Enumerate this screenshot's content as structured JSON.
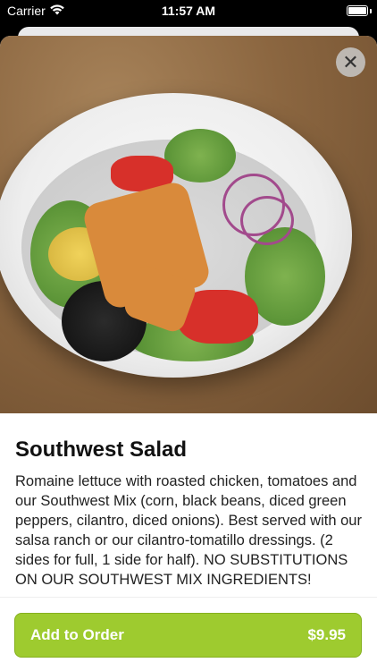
{
  "status_bar": {
    "carrier": "Carrier",
    "time": "11:57 AM"
  },
  "item": {
    "name": "Southwest Salad",
    "description": "Romaine lettuce with roasted chicken, tomatoes and our Southwest Mix (corn, black beans, diced green peppers, cilantro, diced onions). Best served with our salsa ranch or our cilantro-tomatillo dressings. (2 sides for full, 1 side for half). NO SUBSTITUTIONS ON OUR SOUTHWEST MIX INGREDIENTS!",
    "image_alt": "Southwest Salad photo"
  },
  "close": {
    "label": "✕"
  },
  "footer": {
    "add_label": "Add to Order",
    "price": "$9.95"
  },
  "colors": {
    "accent": "#9ecb2f"
  }
}
